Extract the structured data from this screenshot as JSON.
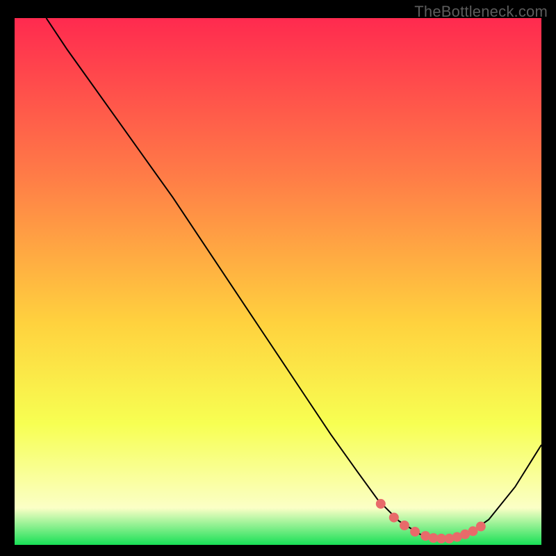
{
  "watermark": "TheBottleneck.com",
  "colors": {
    "background": "#000000",
    "watermark": "#5c5c5c",
    "curve": "#000000",
    "markers": "#e86a6a",
    "gradient_top": "#ff2a4f",
    "gradient_upper_mid": "#ff7c47",
    "gradient_mid": "#ffd23e",
    "gradient_lower_mid": "#f7ff52",
    "gradient_pale": "#fbffc6",
    "gradient_bottom": "#18e056"
  },
  "chart_data": {
    "type": "line",
    "title": "",
    "xlabel": "",
    "ylabel": "",
    "xlim": [
      0,
      100
    ],
    "ylim": [
      0,
      100
    ],
    "series": [
      {
        "name": "bottleneck-curve",
        "x": [
          6,
          10,
          15,
          20,
          25,
          30,
          35,
          40,
          45,
          50,
          55,
          60,
          65,
          69,
          73,
          77,
          80,
          83,
          86,
          90,
          95,
          100
        ],
        "y": [
          100,
          94,
          87,
          80,
          73,
          66,
          58.5,
          51,
          43.5,
          36,
          28.5,
          21,
          14,
          8.5,
          4.5,
          2.0,
          1.2,
          1.2,
          2.0,
          4.8,
          11,
          19
        ]
      }
    ],
    "markers": {
      "name": "flat-region-markers",
      "x": [
        69.5,
        72.0,
        74.0,
        76.0,
        78.0,
        79.5,
        81.0,
        82.5,
        84.0,
        85.5,
        87.0,
        88.5
      ],
      "y": [
        7.8,
        5.2,
        3.7,
        2.5,
        1.7,
        1.3,
        1.2,
        1.2,
        1.5,
        2.0,
        2.6,
        3.5
      ]
    }
  }
}
